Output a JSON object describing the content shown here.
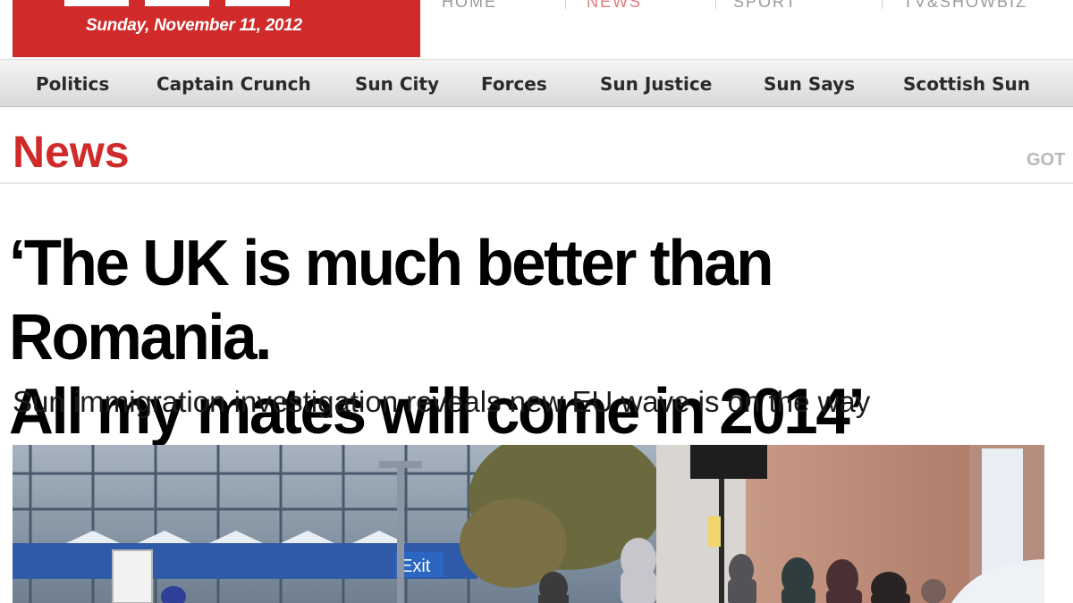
{
  "masthead": {
    "logo_text": "Sun",
    "date": "Sunday, November 11, 2012",
    "brand_color": "#d02a2a"
  },
  "top_nav": {
    "items": [
      "HOME",
      "NEWS",
      "SPORT",
      "TV&SHOWBIZ"
    ]
  },
  "sub_nav": {
    "items": [
      {
        "label": "Politics"
      },
      {
        "label": "Captain Crunch"
      },
      {
        "label": "Sun City"
      },
      {
        "label": "Forces"
      },
      {
        "label": "Sun Justice"
      },
      {
        "label": "Sun Says"
      },
      {
        "label": "Scottish Sun"
      }
    ]
  },
  "section": {
    "title": "News",
    "goto_label": "GOT"
  },
  "article": {
    "headline_line1": "‘The UK is much better than Romania.",
    "headline_line2": "All my mates will come in 2014’",
    "standfirst": "Sun immigration investigation reveals new EU wave is on the way",
    "photo": {
      "sign_text": "Exit"
    }
  }
}
